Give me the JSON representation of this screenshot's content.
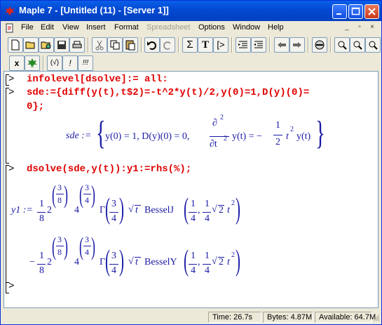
{
  "window": {
    "title": "Maple 7  - [Untitled (11) - [Server 1]]"
  },
  "menu": {
    "items": [
      "File",
      "Edit",
      "View",
      "Insert",
      "Format",
      "Spreadsheet",
      "Options",
      "Window",
      "Help"
    ],
    "disabled": [
      "Spreadsheet"
    ]
  },
  "toolbar2": {
    "labels": [
      "x",
      "(√)",
      "!",
      "!!!"
    ]
  },
  "worksheet": {
    "inputs": [
      "infolevel[dsolve]:= all:",
      "sde:={diff(y(t),t$2)=-t^2*y(t)/2,y(0)=1,D(y)(0)=",
      "0};",
      "dsolve(sde,y(t)):y1:=rhs(%);"
    ],
    "prompt": ">",
    "output1": {
      "lhs": "sde :=",
      "brace_open": "{",
      "ic": "y(0) = 1, D(y)(0) = 0,",
      "d_num": "∂",
      "d_num_exp": "2",
      "d_den": "∂t",
      "d_den_exp": "2",
      "yt": "y(t) = −",
      "frac_num": "1",
      "frac_den": "2",
      "tail": "t",
      "tail_exp": "2",
      "tail2": "y(t)",
      "brace_close": "}"
    },
    "output2": {
      "lhs": "y1 :=",
      "line1_sign": "",
      "line2_sign": "−",
      "c_num": "1",
      "c_den": "8",
      "base2": "2",
      "base4": "4",
      "e1_num": "3",
      "e1_den": "8",
      "e2_num": "3",
      "e2_den": "4",
      "gamma": "Γ",
      "g_num": "3",
      "g_den": "4",
      "sqrt_t": "t",
      "bessel1": "BesselJ",
      "bessel2": "BesselY",
      "b_num1": "1",
      "b_den1": "4",
      "b_num2": "1",
      "b_den2": "4",
      "sqrt2": "2",
      "t2": "t",
      "t2_exp": "2"
    }
  },
  "status": {
    "time": "Time:  26.7s",
    "bytes": "Bytes: 4.87M",
    "available": "Available: 64.7M"
  }
}
